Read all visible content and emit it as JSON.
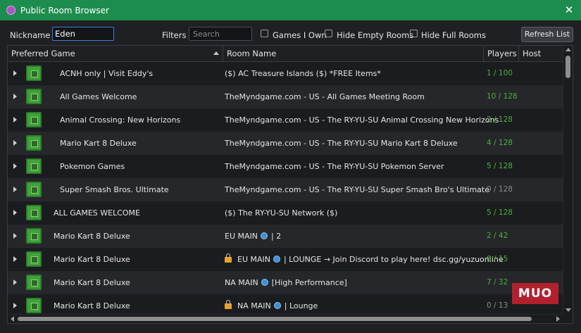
{
  "window": {
    "title": "Public Room Browser"
  },
  "toolbar": {
    "nickname_label": "Nickname",
    "nickname_value": "Eden",
    "filters_label": "Filters",
    "search_placeholder": "Search",
    "games_i_own_label": "Games I Own",
    "hide_empty_label": "Hide Empty Rooms",
    "hide_full_label": "Hide Full Rooms",
    "refresh_label": "Refresh List"
  },
  "table": {
    "columns": [
      "Preferred Game",
      "Room Name",
      "Players",
      "Host"
    ],
    "rows": [
      {
        "game": "ACNH only | Visit Eddy's",
        "room_pre": "($) AC Treasure Islands ($) *FREE Items*",
        "players": "1 / 100"
      },
      {
        "game": "All Games Welcome",
        "room_pre": "TheMyndgame.com - US - All Games Meeting Room",
        "players": "10 / 128"
      },
      {
        "game": "Animal Crossing: New Horizons",
        "room_pre": "TheMyndgame.com - US - The RY-YU-SU Animal Crossing New Horizons",
        "players": "2 / 128"
      },
      {
        "game": "Mario Kart 8 Deluxe",
        "room_pre": "TheMyndgame.com - US - The RY-YU-SU Mario Kart 8 Deluxe",
        "players": "4 / 128"
      },
      {
        "game": "Pokemon Games",
        "room_pre": "TheMyndgame.com - US - The RY-YU-SU Pokemon Server",
        "players": "5 / 128"
      },
      {
        "game": "Super Smash Bros. Ultimate",
        "room_pre": "TheMyndgame.com - US - The RY-YU-SU Super Smash Bro's Ultimate",
        "players": "0 / 128"
      },
      {
        "game": "ALL GAMES WELCOME",
        "room_pre": "($) The RY-YU-SU Network ($)",
        "players": "5 / 128"
      },
      {
        "game": "Mario Kart 8 Deluxe",
        "room_pre": "EU MAIN ",
        "room_post": " | 2",
        "players": "2 / 42"
      },
      {
        "game": "Mario Kart 8 Deluxe",
        "room_pre": "EU MAIN ",
        "room_post": " | LOUNGE → Join Discord to play here! dsc.gg/yuzuonline",
        "players": "8 / 15"
      },
      {
        "game": "Mario Kart 8 Deluxe",
        "room_pre": "NA MAIN ",
        "room_post": " [High Performance]",
        "players": "7 / 32"
      },
      {
        "game": "Mario Kart 8 Deluxe",
        "room_pre": "NA MAIN ",
        "room_post": " | Lounge",
        "players": "0 / 13"
      }
    ]
  },
  "watermark": "MUO",
  "colors": {
    "titlebar": "#1d8d4e",
    "players_active": "#4caf3a",
    "players_empty": "#8a8a8a",
    "watermark": "#b2202e"
  }
}
